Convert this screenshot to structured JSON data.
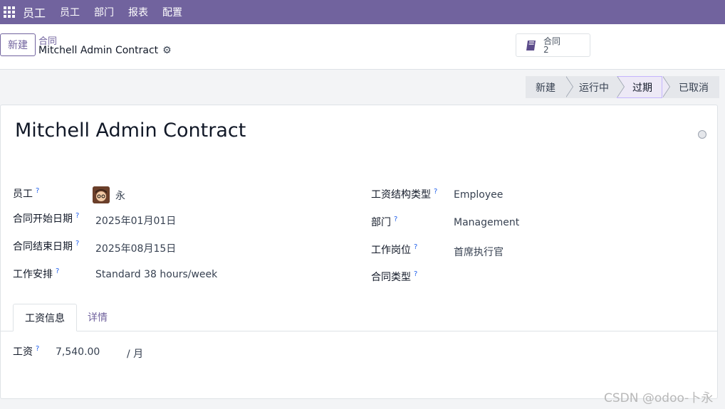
{
  "navbar": {
    "app_name": "员工",
    "menu": [
      "员工",
      "部门",
      "报表",
      "配置"
    ]
  },
  "control": {
    "new_label": "新建",
    "breadcrumb_parent": "合同",
    "breadcrumb_current": "Mitchell Admin Contract",
    "smart_button": {
      "label": "合同",
      "count": "2"
    }
  },
  "statusbar": {
    "stages": [
      "新建",
      "运行中",
      "过期",
      "已取消"
    ],
    "active": "过期"
  },
  "form": {
    "title": "Mitchell Admin Contract",
    "left": [
      {
        "label": "员工",
        "value": "永"
      },
      {
        "label": "合同开始日期",
        "value": "2025年01月01日"
      },
      {
        "label": "合同结束日期",
        "value": "2025年08月15日"
      },
      {
        "label": "工作安排",
        "value": "Standard 38 hours/week"
      }
    ],
    "right": [
      {
        "label": "工资结构类型",
        "value": "Employee"
      },
      {
        "label": "部门",
        "value": "Management"
      },
      {
        "label": "工作岗位",
        "value": "首席执行官"
      },
      {
        "label": "合同类型",
        "value": ""
      }
    ],
    "help_marker": "?",
    "tabs": [
      "工资信息",
      "详情"
    ],
    "wage": {
      "label": "工资",
      "value": "7,540.00",
      "unit": "/ 月"
    }
  },
  "watermark": "CSDN @odoo-卜永"
}
